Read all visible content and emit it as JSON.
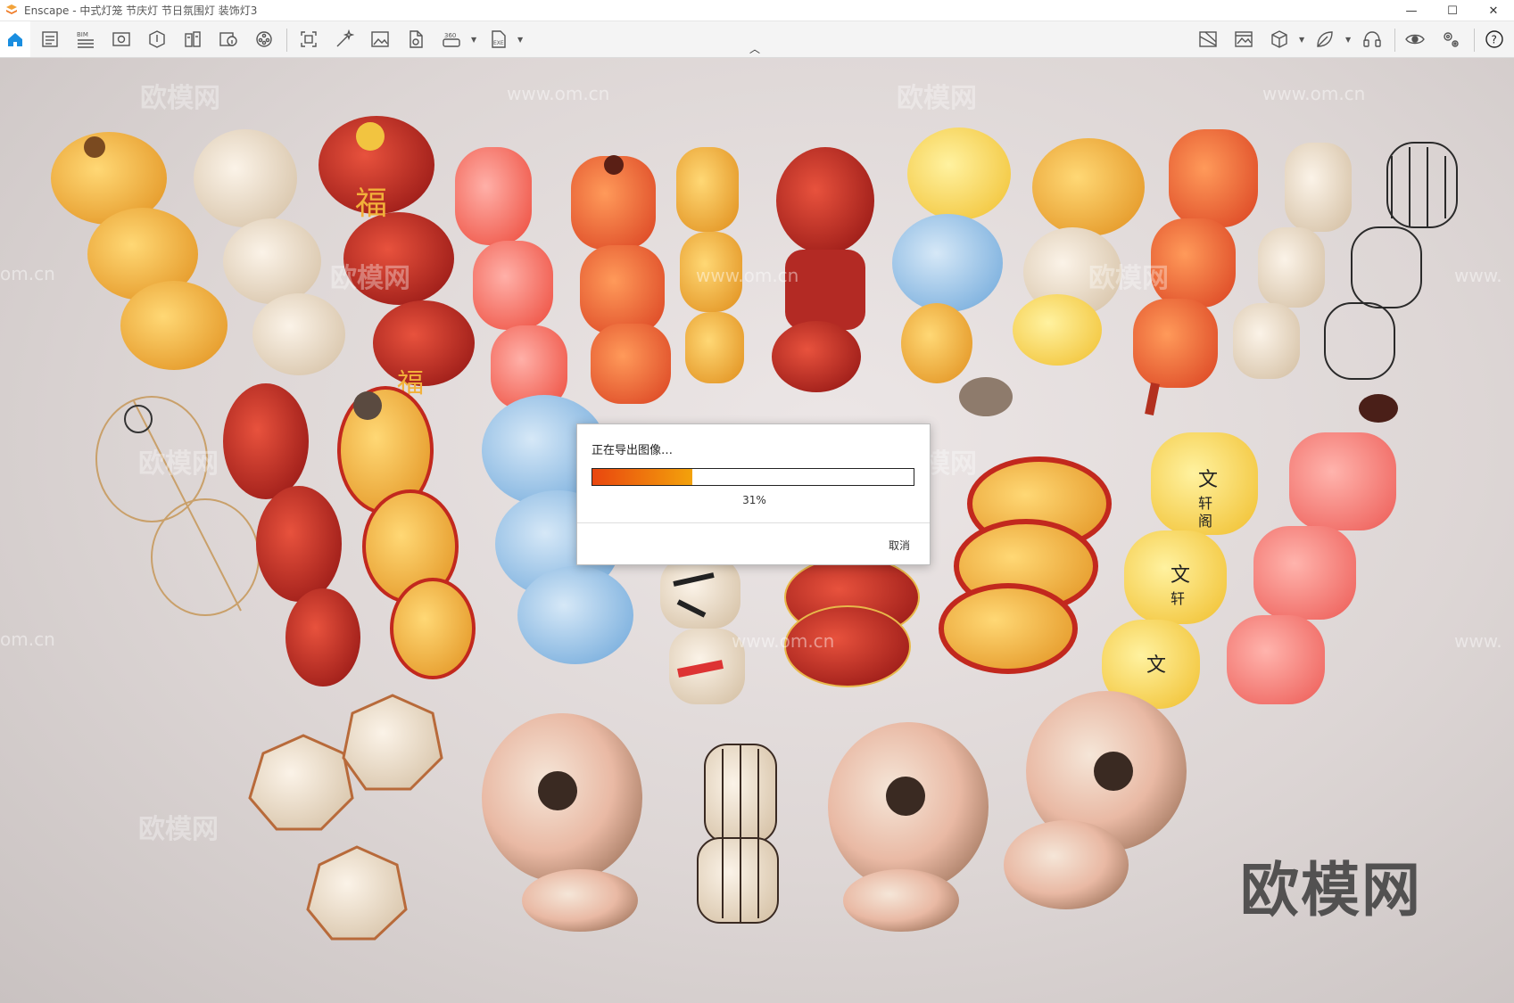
{
  "window": {
    "title": "Enscape - 中式灯笼 节庆灯 节日氛围灯 装饰灯3",
    "controls": {
      "minimize": "—",
      "maximize": "☐",
      "close": "✕"
    }
  },
  "toolbar": {
    "left_icons": [
      "home-icon",
      "document-icon",
      "bim-icon",
      "view-icon",
      "asset-library-icon",
      "building-icon",
      "info-icon",
      "video-editor-icon",
      "screenshot-icon",
      "magic-wand-icon",
      "image-icon",
      "export-file-icon",
      "panorama-360-icon",
      "exe-export-icon"
    ],
    "right_icons": [
      "map-icon",
      "gallery-icon",
      "cube-icon",
      "leaf-icon",
      "headset-icon",
      "eye-icon",
      "settings-icon",
      "help-icon"
    ],
    "bim_label": "BIM",
    "pano_label": "360",
    "exe_label": "EXE",
    "help_label": "?"
  },
  "viewport": {
    "watermarks": [
      "欧模网",
      "欧模网",
      "欧模网",
      "欧模网",
      "欧模网",
      "欧模网",
      "欧模网"
    ],
    "watermark_urls": [
      "www.om.cn",
      "www.om.cn",
      "om.cn",
      "www.om.cn",
      "om.cn",
      "www.om.cn",
      "www.",
      "www."
    ],
    "brand_mark": "欧模网",
    "lantern_text": {
      "fu": "福",
      "wen": "文",
      "xuan": "轩",
      "ge": "阁"
    }
  },
  "dialog": {
    "title": "正在导出图像…",
    "progress_percent": 31,
    "progress_label": "31%",
    "cancel_label": "取消"
  },
  "colors": {
    "progress_start": "#e9460f",
    "progress_end": "#f3a20b",
    "home_active": "#1a8ee0"
  }
}
